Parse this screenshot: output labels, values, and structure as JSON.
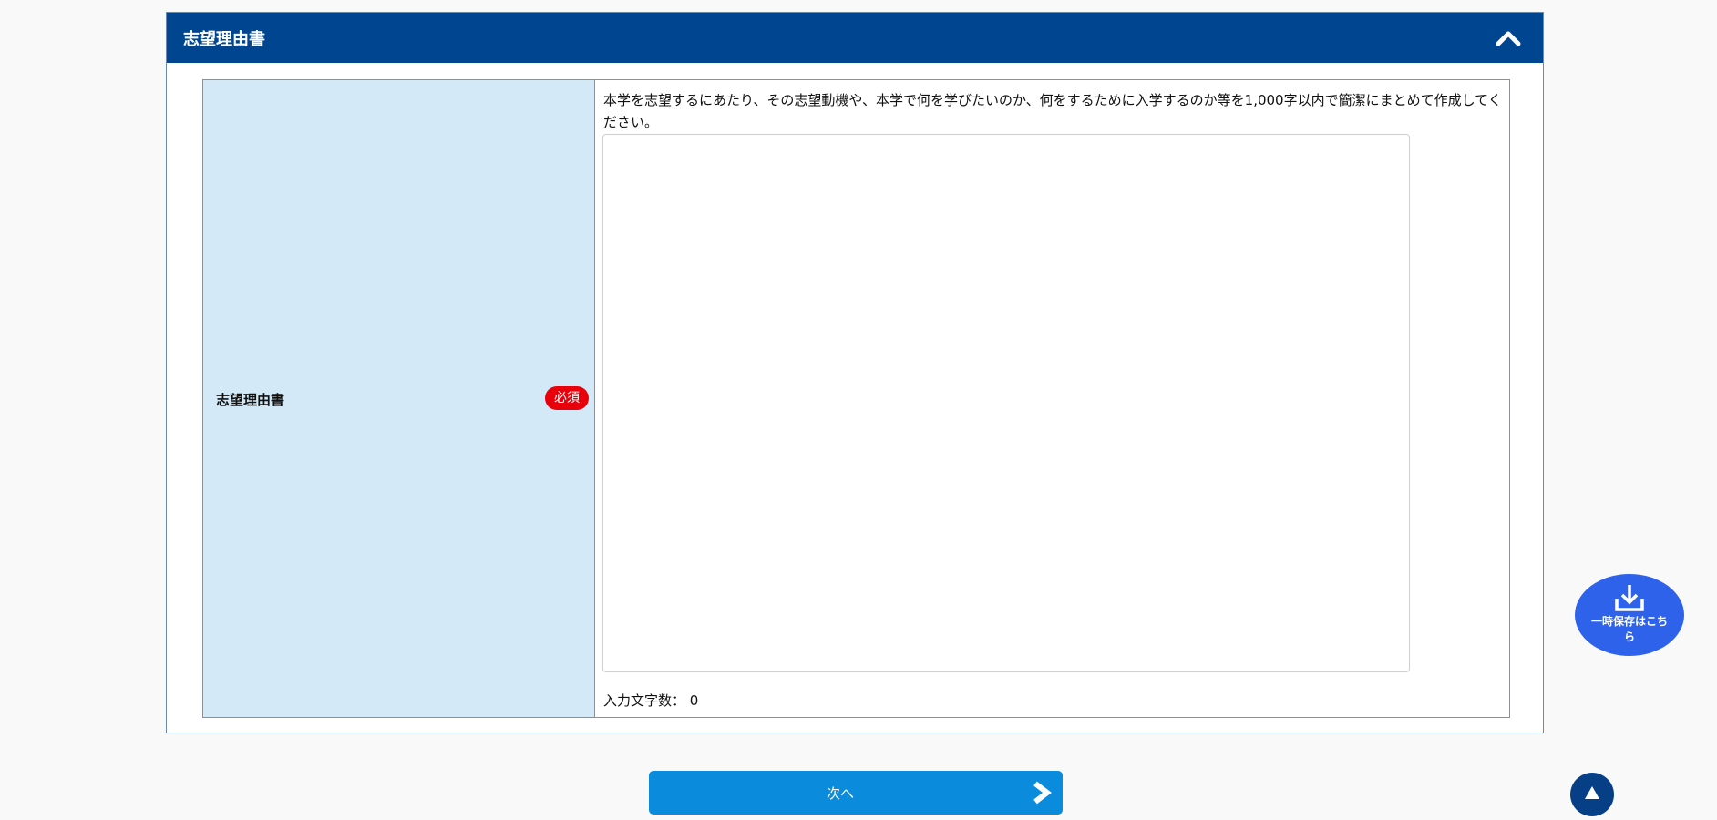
{
  "section": {
    "title": "志望理由書",
    "collapse_icon": "chevron-up-icon"
  },
  "form": {
    "field_label": "志望理由書",
    "required_badge": "必須",
    "instruction": "本学を志望するにあたり、その志望動機や、本学で何を学びたいのか、何をするために入学するのか等を1,000字以内で簡潔にまとめて作成してください。",
    "textarea_value": "",
    "char_count_label": "入力文字数：",
    "char_count_value": "0"
  },
  "next_button": {
    "label": "次へ",
    "icon": "chevron-right-icon"
  },
  "save_button": {
    "label": "一時保存はこちら",
    "icon": "download-icon"
  },
  "scroll_top_button": {
    "icon": "triangle-up-icon"
  },
  "colors": {
    "header_bg": "#00458f",
    "label_cell_bg": "#d3e9f8",
    "required_badge": "#e8000b",
    "next_button": "#0a8bdc",
    "save_button": "#2f62ea",
    "top_button": "#073f86"
  }
}
